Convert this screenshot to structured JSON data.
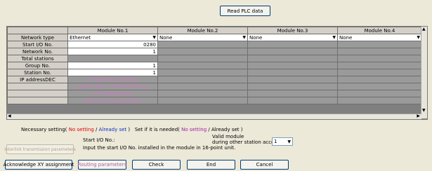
{
  "buttons": {
    "read_plc": "Read PLC data",
    "interlink": "Interlink transmission parameters",
    "ack_xy": "Acknowledge XY assignment",
    "routing": "Routing parameters",
    "check": "Check",
    "end": "End",
    "cancel": "Cancel"
  },
  "grid": {
    "columns": [
      "Module No.1",
      "Module No.2",
      "Module No.3",
      "Module No.4"
    ],
    "rows": [
      {
        "label": "Network type",
        "cells": [
          "Ethernet",
          "None",
          "None",
          "None"
        ]
      },
      {
        "label": "Start I/O No.",
        "cells": [
          "0280",
          "",
          "",
          ""
        ]
      },
      {
        "label": "Network No.",
        "cells": [
          "1",
          "",
          "",
          ""
        ]
      },
      {
        "label": "Total stations",
        "cells": [
          "",
          "",
          "",
          ""
        ]
      },
      {
        "label": "Group No.",
        "cells": [
          "1",
          "",
          "",
          ""
        ]
      },
      {
        "label": "Station No.",
        "cells": [
          "1",
          "",
          "",
          ""
        ]
      },
      {
        "label": "IP addressDEC",
        "cells": [
          "IP Address Settings",
          "",
          "",
          ""
        ]
      },
      {
        "label": "",
        "cells": [
          "Station No.<->IP information",
          "",
          "",
          ""
        ]
      },
      {
        "label": "",
        "cells": [
          "FTP Parameters",
          "",
          "",
          ""
        ]
      },
      {
        "label": "",
        "cells": [
          "Router relay parameter",
          "",
          "",
          ""
        ]
      }
    ]
  },
  "legend": {
    "necessary": "Necessary setting(",
    "no_setting": "No setting",
    "slash": "/",
    "already_set": "Already set",
    "close": ")",
    "set_if_needed": "Set if it is needed(",
    "no_setting2": "No setting",
    "already_set2": "Already set",
    "close2": ")"
  },
  "info": {
    "start_io_label": "Start I/O No.:",
    "hint": "Input the start I/O No. installed in the module in 16-point unit.",
    "valid_module_1": "Valid module",
    "valid_module_2": "during other station access",
    "valid_value": "1"
  }
}
